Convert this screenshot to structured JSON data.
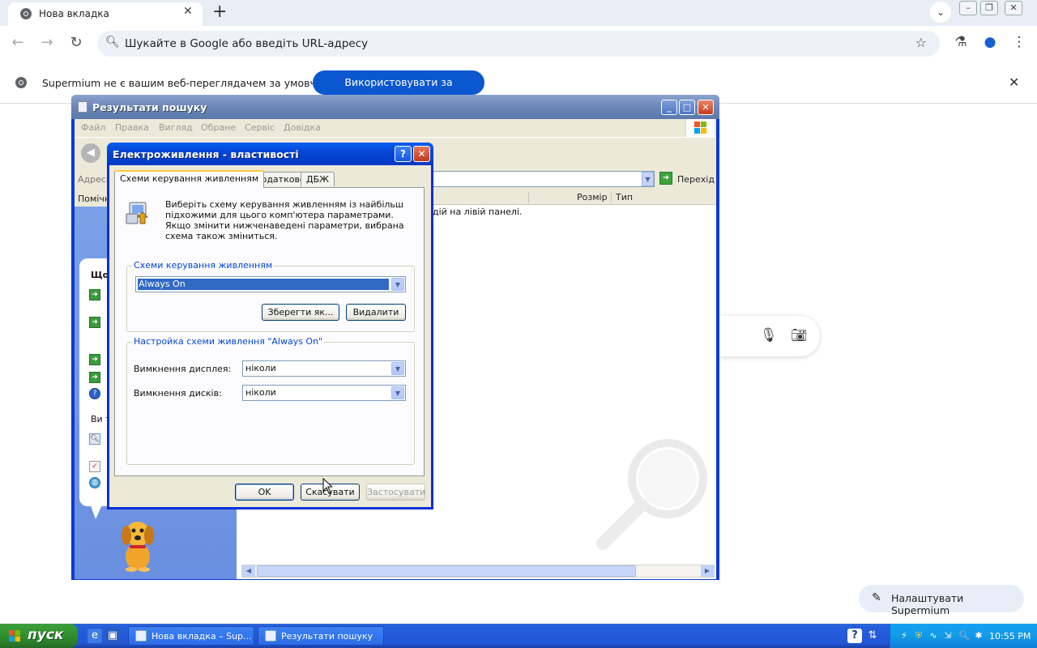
{
  "browser": {
    "tab_title": "Нова вкладка",
    "tab_close": "✕",
    "new_tab": "+",
    "omnibox_placeholder": "Шукайте в Google або введіть URL-адресу",
    "infobar_message": "Supermium не є вашим веб-переглядачем за умовчанням",
    "infobar_button": "Використовувати за умовчанням",
    "customize_label": "Налаштувати Supermium"
  },
  "explorer": {
    "title": "Результати пошуку",
    "menu": [
      "Файл",
      "Правка",
      "Вигляд",
      "Обране",
      "Сервіс",
      "Довідка"
    ],
    "address_label": "Адреса",
    "go_label": "Перехід",
    "left_header": "Помічн",
    "columns": [
      "Розмір",
      "Тип"
    ],
    "hint": "дій на лівій панелі.",
    "balloon_question": "Що",
    "balloon_text": "Ви т"
  },
  "dialog": {
    "title": "Електроживлення - властивості",
    "help": "?",
    "close": "✕",
    "tabs": [
      "Схеми керування живленням",
      "Додатково",
      "ДБЖ"
    ],
    "intro": "Виберіть схему керування живленням із найбільш підхожими для цього комп'ютера параметрами. Якщо змінити нижченаведені параметри, вибрана схема також зміниться.",
    "scheme_group": "Схеми керування живленням",
    "scheme_selected": "Always On",
    "save_as": "Зберегти як...",
    "delete": "Видалити",
    "settings_group": "Настройка схеми живлення \"Always On\"",
    "display_label": "Вимкнення дисплея:",
    "display_value": "ніколи",
    "disks_label": "Вимкнення дисків:",
    "disks_value": "ніколи",
    "ok": "OK",
    "cancel": "Скасувати",
    "apply": "Застосувати"
  },
  "taskbar": {
    "start": "пуск",
    "tasks": [
      "Нова вкладка – Sup...",
      "Результати пошуку"
    ],
    "clock": "10:55 PM"
  }
}
